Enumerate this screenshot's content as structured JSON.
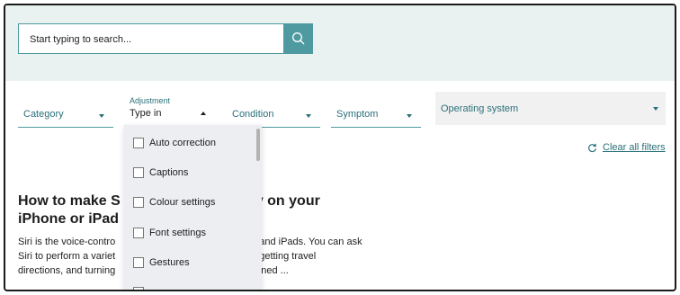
{
  "search": {
    "placeholder": "Start typing to search..."
  },
  "filters": {
    "category": "Category",
    "adjustment_label": "Adjustment",
    "adjustment_value": "Type in",
    "condition": "Condition",
    "symptom": "Symptom",
    "os": "Operating system"
  },
  "clear_all": "Clear all filters",
  "adjustment_options": [
    "Auto correction",
    "Captions",
    "Colour settings",
    "Font settings",
    "Gestures"
  ],
  "article": {
    "title_line1_a": "How to make S",
    "title_line1_b": "y on your",
    "title_line2": "iPhone or iPad",
    "body_line1_a": "Siri is the voice-contro",
    "body_line1_b": "and iPads. You can ask",
    "body_line2_a": "Siri to perform a variet",
    "body_line2_b": "getting travel",
    "body_line3_a": "directions, and turning",
    "body_line3_b": "ned ..."
  },
  "colors": {
    "accent": "#4e9aa0",
    "band": "#e9f2f1",
    "dropdown": "#eceef1"
  }
}
